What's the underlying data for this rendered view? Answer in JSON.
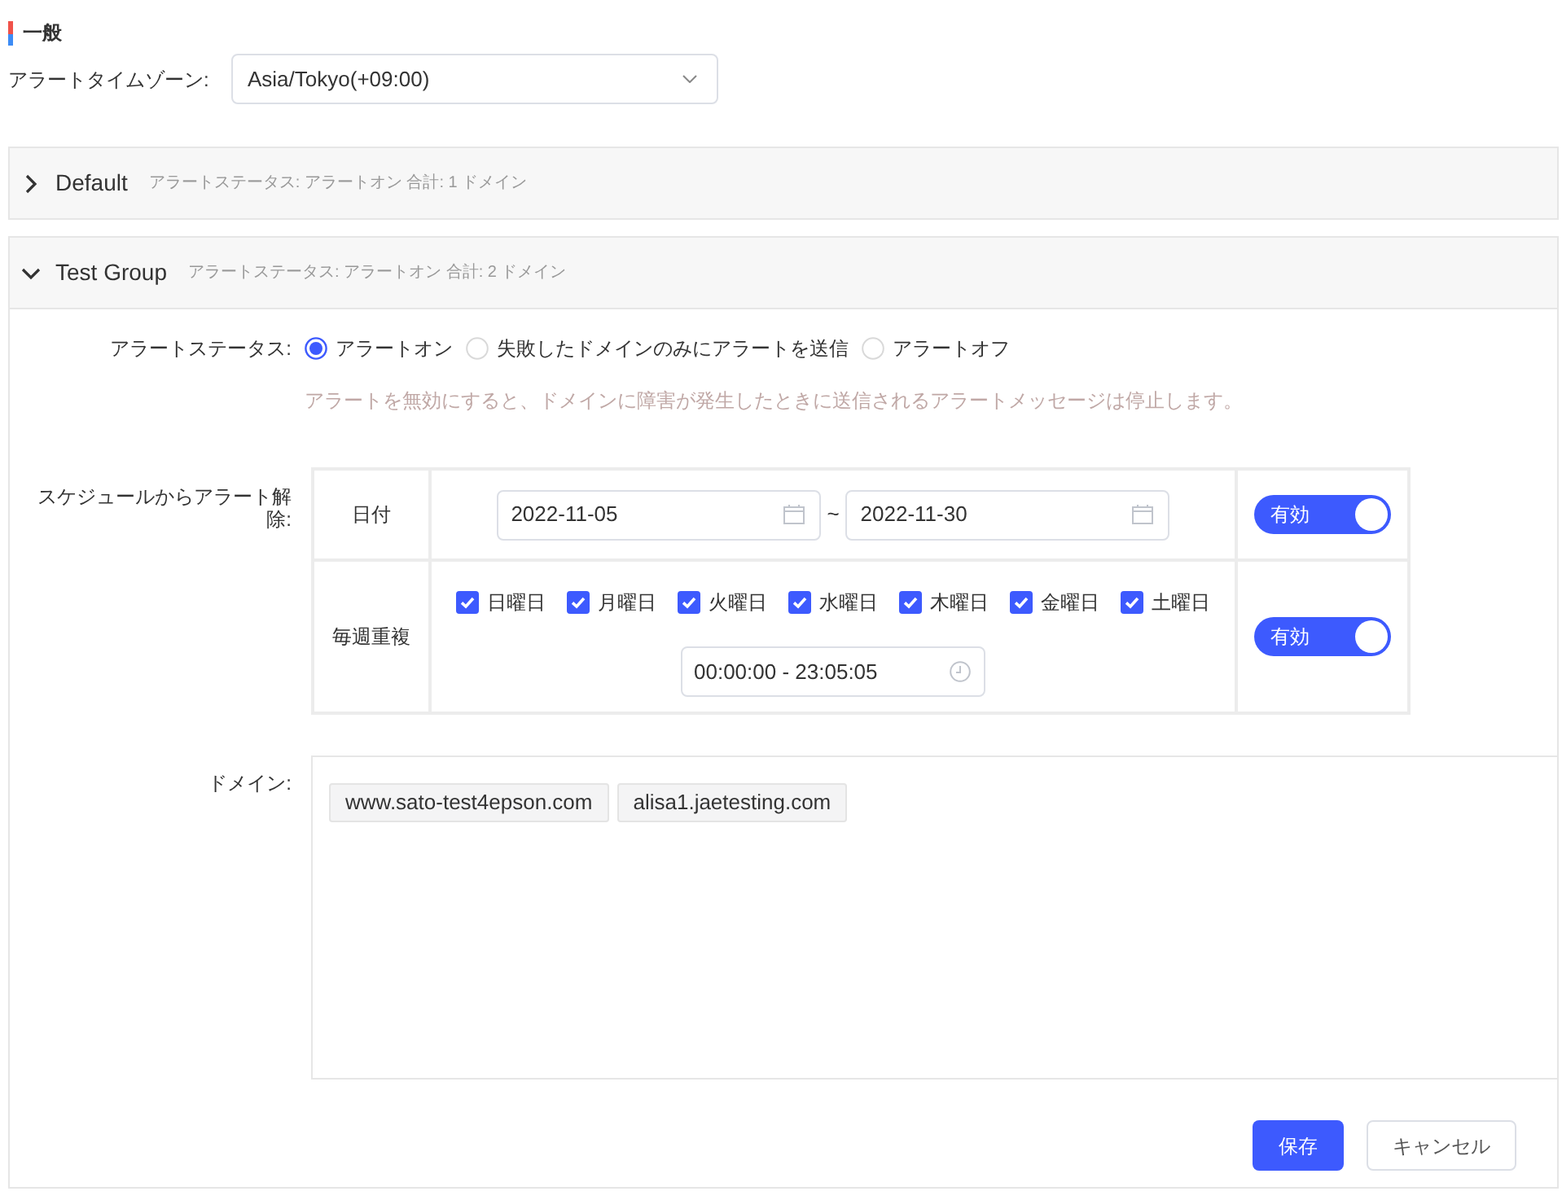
{
  "general": {
    "title": "一般",
    "timezone": {
      "label": "アラートタイムゾーン:",
      "value": "Asia/Tokyo(+09:00)"
    }
  },
  "groups": [
    {
      "name": "Default",
      "summary": "アラートステータス: アラートオン 合計: 1 ドメイン",
      "expanded": false
    },
    {
      "name": "Test Group",
      "summary": "アラートステータス: アラートオン 合計: 2 ドメイン",
      "expanded": true,
      "alert_status": {
        "label": "アラートステータス:",
        "options": [
          {
            "label": "アラートオン",
            "selected": true
          },
          {
            "label": "失敗したドメインのみにアラートを送信",
            "selected": false
          },
          {
            "label": "アラートオフ",
            "selected": false
          }
        ],
        "hint": "アラートを無効にすると、ドメインに障害が発生したときに送信されるアラートメッセージは停止します。"
      },
      "schedule": {
        "label": "スケジュールからアラート解除:",
        "rows": [
          {
            "kind": "date_range",
            "label": "日付",
            "start": "2022-11-05",
            "separator": "~",
            "end": "2022-11-30",
            "toggle": {
              "label": "有効",
              "on": true
            }
          },
          {
            "kind": "weekly",
            "label": "毎週重複",
            "days": [
              {
                "label": "日曜日",
                "checked": true
              },
              {
                "label": "月曜日",
                "checked": true
              },
              {
                "label": "火曜日",
                "checked": true
              },
              {
                "label": "水曜日",
                "checked": true
              },
              {
                "label": "木曜日",
                "checked": true
              },
              {
                "label": "金曜日",
                "checked": true
              },
              {
                "label": "土曜日",
                "checked": true
              }
            ],
            "time_range": "00:00:00 - 23:05:05",
            "toggle": {
              "label": "有効",
              "on": true
            }
          }
        ]
      },
      "domains": {
        "label": "ドメイン:",
        "tags": [
          "www.sato-test4epson.com",
          "alisa1.jaetesting.com"
        ]
      },
      "buttons": [
        {
          "label": "保存",
          "kind": "primary"
        },
        {
          "label": "キャンセル",
          "kind": "default"
        }
      ]
    }
  ]
}
